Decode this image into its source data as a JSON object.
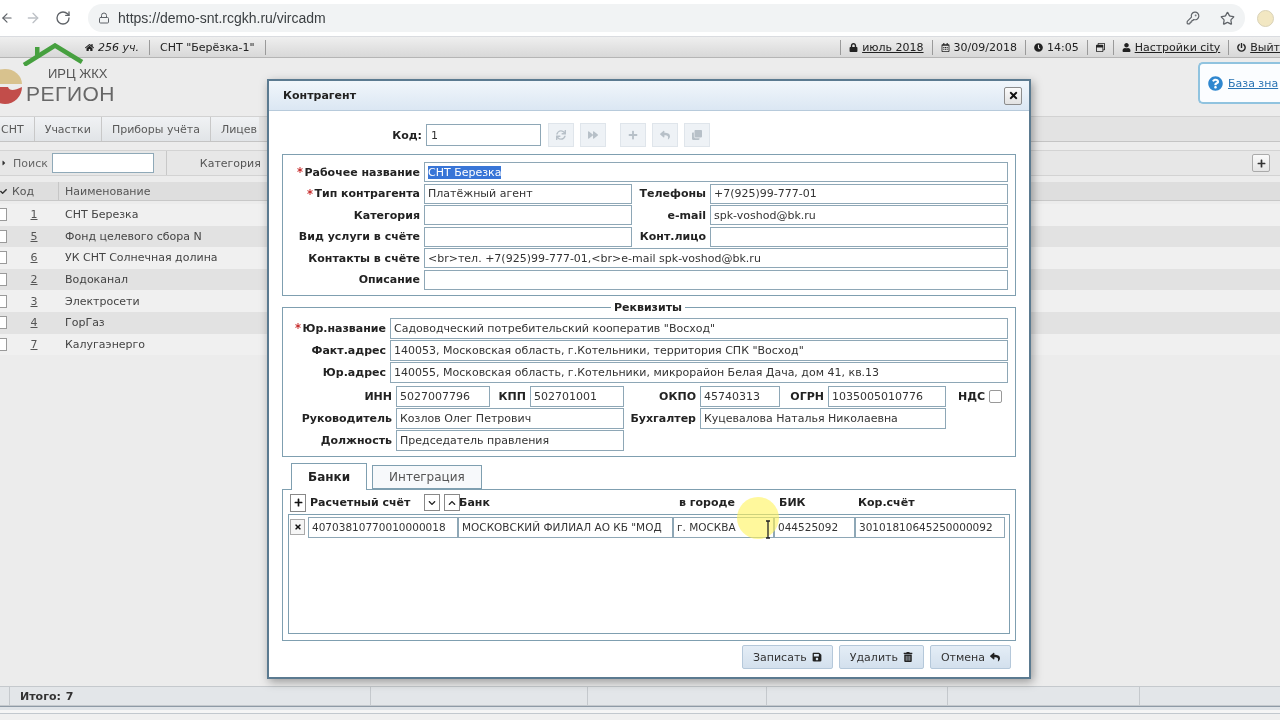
{
  "browser": {
    "url": "https://demo-snt.rcgkh.ru/vircadm"
  },
  "header_bar": {
    "left": [
      {
        "label": "256 уч.",
        "kind": "count"
      },
      {
        "label": "СНТ \"Берёзка-1\"",
        "kind": "text"
      }
    ],
    "right": [
      {
        "label": "июль 2018",
        "kind": "link"
      },
      {
        "label": "30/09/2018",
        "kind": "text"
      },
      {
        "label": "14:05",
        "kind": "text"
      },
      {
        "label": "Настройки city",
        "kind": "link"
      },
      {
        "label": "Выйт",
        "kind": "link"
      }
    ]
  },
  "logo": {
    "top_line": "ИРЦ ЖКХ",
    "bottom_line": "РЕГИОН"
  },
  "help_link": {
    "label": "База зна"
  },
  "main_tabs": [
    {
      "label": "СНТ",
      "selected": false
    },
    {
      "label": "Участки",
      "selected": false
    },
    {
      "label": "Приборы учёта",
      "selected": false
    },
    {
      "label": "Лицев",
      "selected": false
    }
  ],
  "search": {
    "label": "Поиск",
    "category_label": "Категория"
  },
  "table": {
    "columns": [
      "Код",
      "Наименование"
    ],
    "rows": [
      {
        "code": "1",
        "name": "СНТ Березка",
        "checked": false
      },
      {
        "code": "5",
        "name": "Фонд целевого сбора N",
        "checked": false
      },
      {
        "code": "6",
        "name": "УК СНТ Солнечная долина",
        "checked": false
      },
      {
        "code": "2",
        "name": "Водоканал",
        "checked": false
      },
      {
        "code": "3",
        "name": "Электросети",
        "checked": false
      },
      {
        "code": "4",
        "name": "ГорГаз",
        "checked": false
      },
      {
        "code": "7",
        "name": "Калугаэнерго",
        "checked": false
      }
    ]
  },
  "status_bar": {
    "label": "Итого:",
    "value": "7"
  },
  "dialog": {
    "title": "Контрагент",
    "code": {
      "label": "Код:",
      "value": "1"
    },
    "toolbar": [
      {
        "disabled": true
      },
      {
        "disabled": true
      },
      {
        "disabled": true
      },
      {
        "disabled": true
      },
      {
        "disabled": true
      }
    ],
    "general": [
      [
        {
          "label": "Рабочее название",
          "value": "СНТ Березка",
          "required": true,
          "text_selected": true
        }
      ],
      [
        {
          "label": "Тип контрагента",
          "value": "Платёжный агент",
          "required": true,
          "text_selected": false
        },
        {
          "label": "Телефоны",
          "value": "+7(925)99-777-01",
          "required": false,
          "text_selected": false
        }
      ],
      [
        {
          "label": "Категория",
          "required": false
        },
        {
          "label": "e-mail",
          "value": "spk-voshod@bk.ru",
          "required": false,
          "text_selected": false
        }
      ],
      [
        {
          "label": "Вид услуги в счёте",
          "required": false
        },
        {
          "label": "Конт.лицо",
          "required": false
        }
      ],
      [
        {
          "label": "Контакты в счёте",
          "value": "<br>тел. +7(925)99-777-01,<br>e-mail spk-voshod@bk.ru",
          "required": false,
          "text_selected": false
        }
      ],
      [
        {
          "label": "Описание",
          "required": false
        }
      ]
    ],
    "requisites": {
      "legend": "Реквизиты",
      "full_rows": [
        {
          "label": "Юр.название",
          "value": "Садоводческий потребительский кооператив \"Восход\"",
          "required": true
        },
        {
          "label": "Факт.адрес",
          "value": "140053, Московская область, г.Котельники, территория СПК \"Восход\"",
          "required": false
        },
        {
          "label": "Юр.адрес",
          "value": "140055, Московская область, г.Котельники, микрорайон Белая Дача, дом 41, кв.13",
          "required": false
        }
      ],
      "grid_rows": [
        [
          {
            "kind": "text",
            "label": "ИНН",
            "value": "5027007796"
          },
          {
            "kind": "text",
            "label": "КПП",
            "value": "502701001"
          },
          {
            "kind": "text",
            "label": "ОКПО",
            "value": "45740313"
          },
          {
            "kind": "text",
            "label": "ОГРН",
            "value": "1035005010776"
          },
          {
            "kind": "checkbox",
            "label": "НДС",
            "checked": false
          }
        ],
        [
          {
            "kind": "text",
            "label": "Руководитель",
            "value": "Козлов Олег Петрович"
          },
          {
            "kind": "text",
            "label": "Бухгалтер",
            "value": "Куцевалова Наталья Николаевна"
          }
        ],
        [
          {
            "kind": "text",
            "label": "Должность",
            "value": "Председатель правления"
          }
        ]
      ]
    },
    "tabs": [
      {
        "label": "Банки",
        "selected": true
      },
      {
        "label": "Интеграция",
        "selected": false
      }
    ],
    "banks": {
      "columns": [
        "Расчетный счёт",
        "Банк",
        "в городе",
        "БИК",
        "Кор.счёт"
      ],
      "rows": [
        [
          "40703810770010000018",
          "МОСКОВСКИЙ ФИЛИАЛ АО КБ \"МОД",
          "г. МОСКВА",
          "044525092",
          "30101810645250000092"
        ]
      ]
    },
    "buttons": [
      {
        "label": "Записать"
      },
      {
        "label": "Удалить"
      },
      {
        "label": "Отмена"
      }
    ]
  }
}
